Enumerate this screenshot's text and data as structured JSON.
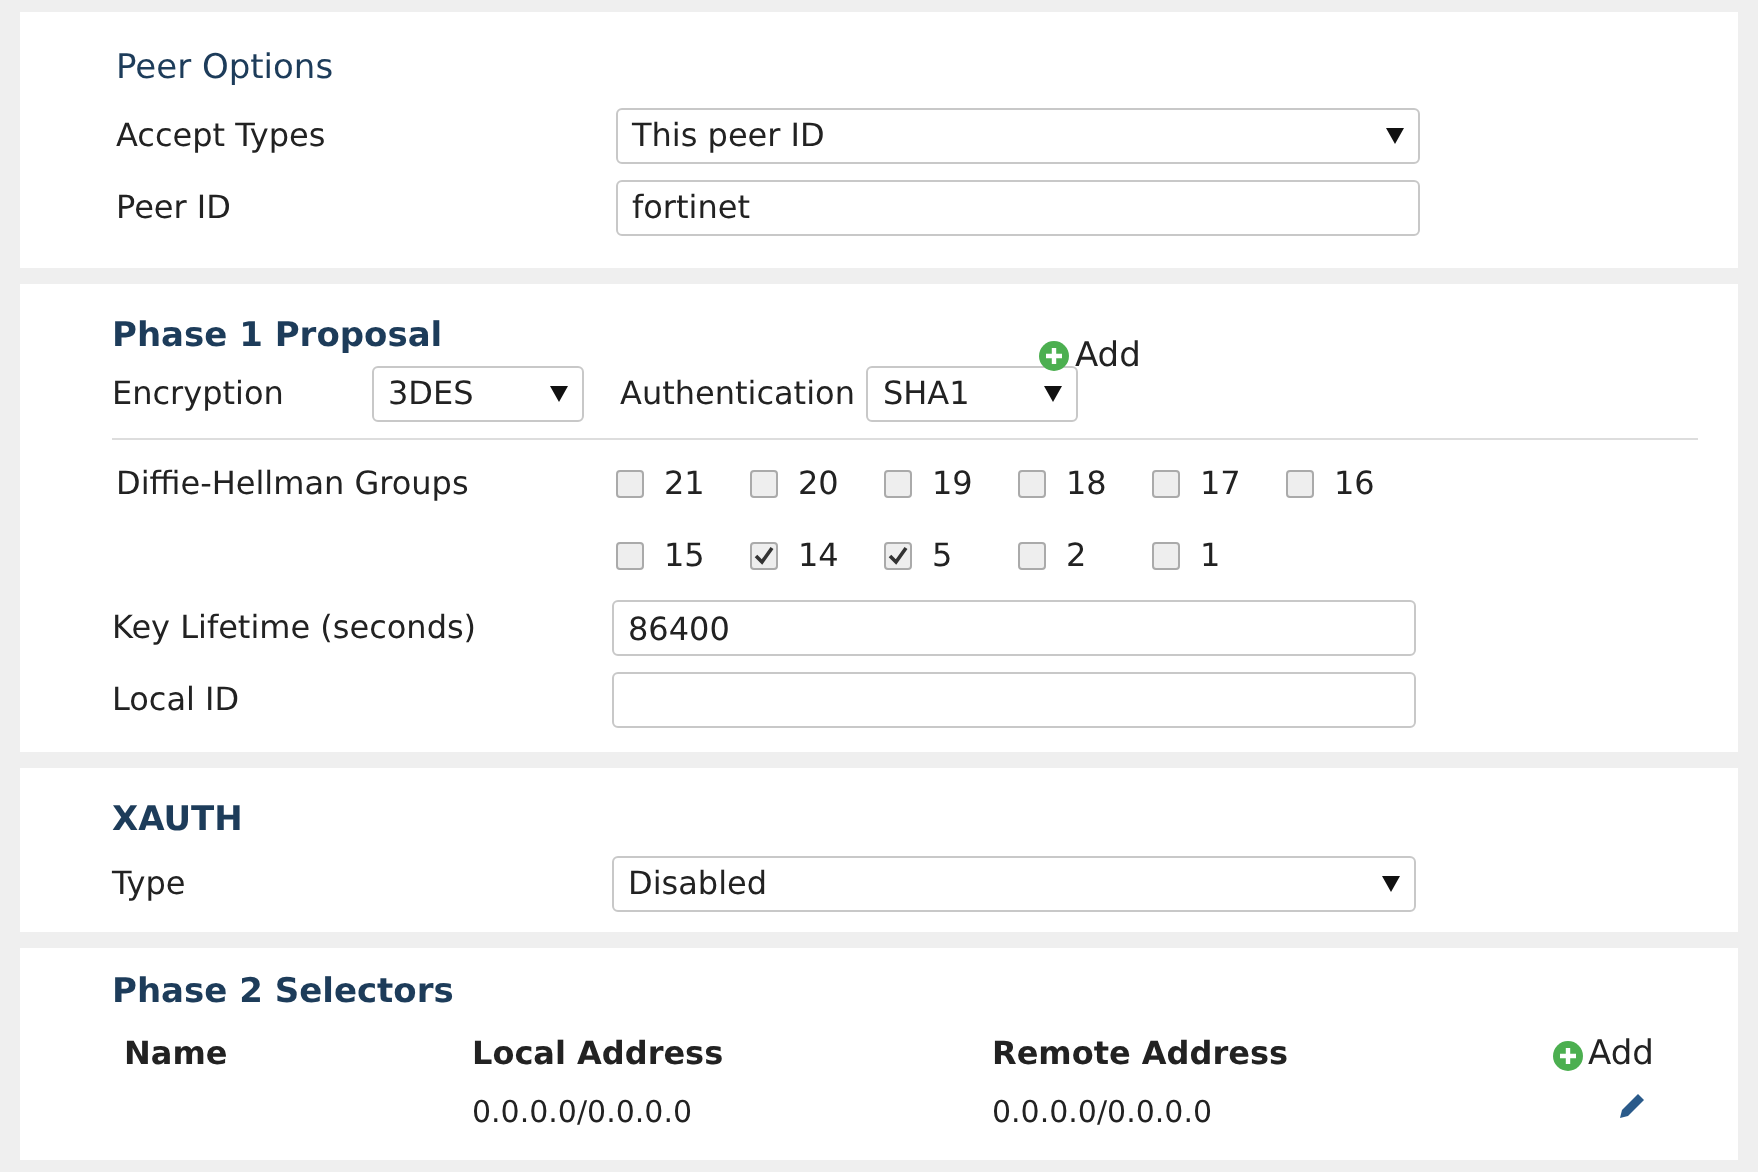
{
  "peer_options": {
    "title": "Peer Options",
    "fields": [
      {
        "label": "Accept Types",
        "kind": "select",
        "value": "This peer ID"
      },
      {
        "label": "Peer ID",
        "kind": "input",
        "value": "fortinet"
      }
    ]
  },
  "phase1": {
    "title": "Phase 1 Proposal",
    "add": "Add",
    "encryption": {
      "label": "Encryption",
      "value": "3DES"
    },
    "authentication": {
      "label": "Authentication",
      "value": "SHA1"
    },
    "dh": {
      "label": "Diffie-Hellman Groups",
      "groups": [
        {
          "label": "21",
          "checked": false
        },
        {
          "label": "20",
          "checked": false
        },
        {
          "label": "19",
          "checked": false
        },
        {
          "label": "18",
          "checked": false
        },
        {
          "label": "17",
          "checked": false
        },
        {
          "label": "16",
          "checked": false
        },
        {
          "label": "15",
          "checked": false
        },
        {
          "label": "14",
          "checked": true
        },
        {
          "label": "5",
          "checked": true
        },
        {
          "label": "2",
          "checked": false
        },
        {
          "label": "1",
          "checked": false
        }
      ]
    },
    "fields": [
      {
        "label": "Key Lifetime (seconds)",
        "kind": "input",
        "value": "86400"
      },
      {
        "label": "Local ID",
        "kind": "input"
      }
    ]
  },
  "xauth": {
    "title": "XAUTH",
    "fields": [
      {
        "label": "Type",
        "kind": "select",
        "value": "Disabled"
      }
    ]
  },
  "phase2": {
    "title": "Phase 2 Selectors",
    "add": "Add",
    "columns": [
      "Name",
      "Local Address",
      "Remote Address"
    ],
    "rows": [
      {
        "cells": [
          "",
          "0.0.0.0/0.0.0.0",
          "0.0.0.0/0.0.0.0"
        ]
      }
    ]
  }
}
